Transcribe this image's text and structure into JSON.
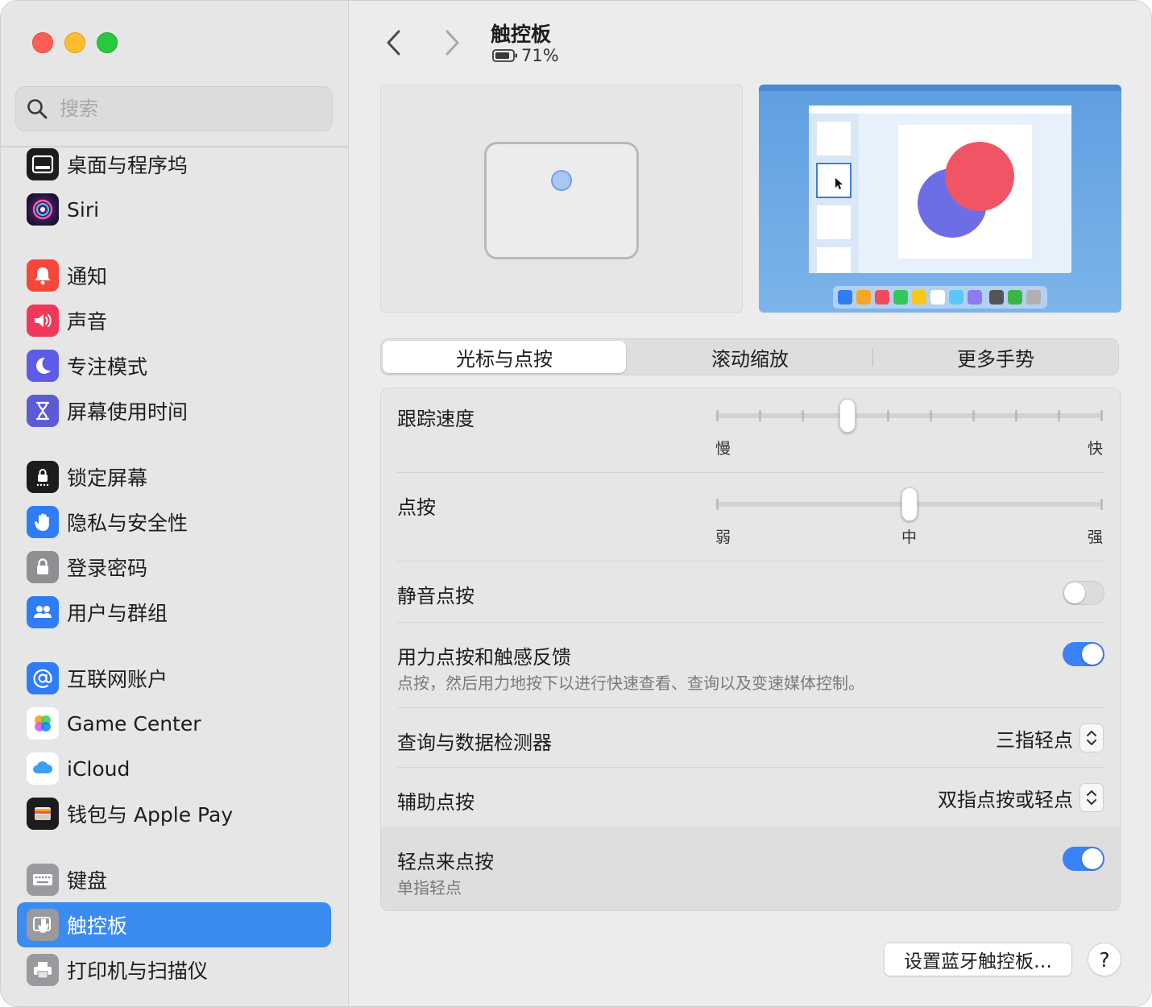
{
  "window": {
    "title": "触控板",
    "battery_percent": "71%"
  },
  "search": {
    "placeholder": "搜索"
  },
  "sidebar": {
    "items": [
      {
        "label": "桌面与程序坞",
        "icon": "dock-icon"
      },
      {
        "label": "Siri",
        "icon": "siri-icon"
      },
      {
        "label": "通知",
        "icon": "notifications-icon"
      },
      {
        "label": "声音",
        "icon": "sound-icon"
      },
      {
        "label": "专注模式",
        "icon": "focus-moon-icon"
      },
      {
        "label": "屏幕使用时间",
        "icon": "hourglass-icon"
      },
      {
        "label": "锁定屏幕",
        "icon": "lock-screen-icon"
      },
      {
        "label": "隐私与安全性",
        "icon": "privacy-hand-icon"
      },
      {
        "label": "登录密码",
        "icon": "padlock-icon"
      },
      {
        "label": "用户与群组",
        "icon": "users-icon"
      },
      {
        "label": "互联网账户",
        "icon": "at-icon"
      },
      {
        "label": "Game Center",
        "icon": "game-center-icon"
      },
      {
        "label": "iCloud",
        "icon": "icloud-icon"
      },
      {
        "label": "钱包与 Apple Pay",
        "icon": "wallet-icon"
      },
      {
        "label": "键盘",
        "icon": "keyboard-icon"
      },
      {
        "label": "触控板",
        "icon": "trackpad-icon",
        "selected": true
      },
      {
        "label": "打印机与扫描仪",
        "icon": "printer-icon"
      }
    ]
  },
  "tabs": [
    {
      "label": "光标与点按",
      "selected": true
    },
    {
      "label": "滚动缩放",
      "selected": false
    },
    {
      "label": "更多手势",
      "selected": false
    }
  ],
  "settings": {
    "tracking_speed": {
      "label": "跟踪速度",
      "min_label": "慢",
      "max_label": "快",
      "value": 0.34
    },
    "click": {
      "label": "点按",
      "min_label": "弱",
      "mid_label": "中",
      "max_label": "强",
      "value": 0.5
    },
    "silent_click": {
      "label": "静音点按",
      "enabled": false
    },
    "force_click": {
      "label": "用力点按和触感反馈",
      "description": "点按，然后用力地按下以进行快速查看、查询以及变速媒体控制。",
      "enabled": true
    },
    "lookup": {
      "label": "查询与数据检测器",
      "value": "三指轻点"
    },
    "secondary_click": {
      "label": "辅助点按",
      "value": "双指点按或轻点"
    },
    "tap_to_click": {
      "label": "轻点来点按",
      "description": "单指轻点",
      "enabled": true
    }
  },
  "buttons": {
    "bluetooth_setup": "设置蓝牙触控板…",
    "help": "?"
  },
  "colors": {
    "accent": "#3b82f6",
    "sidebar_selected": "#3b8cf0"
  }
}
